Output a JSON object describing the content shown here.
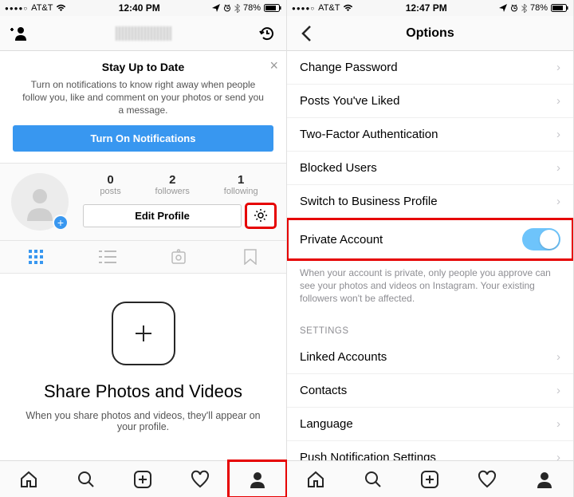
{
  "left": {
    "status": {
      "carrier": "AT&T",
      "time": "12:40 PM",
      "battery": "78%"
    },
    "banner": {
      "title": "Stay Up to Date",
      "body": "Turn on notifications to know right away when people follow you, like and comment on your photos or send you a message.",
      "cta": "Turn On Notifications"
    },
    "stats": {
      "posts_num": "0",
      "posts_lbl": "posts",
      "followers_num": "2",
      "followers_lbl": "followers",
      "following_num": "1",
      "following_lbl": "following"
    },
    "edit_label": "Edit Profile",
    "empty": {
      "title": "Share Photos and Videos",
      "body": "When you share photos and videos, they'll appear on your profile."
    }
  },
  "right": {
    "status": {
      "carrier": "AT&T",
      "time": "12:47 PM",
      "battery": "78%"
    },
    "title": "Options",
    "rows": {
      "change_password": "Change Password",
      "posts_liked": "Posts You've Liked",
      "two_factor": "Two-Factor Authentication",
      "blocked": "Blocked Users",
      "switch_business": "Switch to Business Profile",
      "private_account": "Private Account",
      "private_desc": "When your account is private, only people you approve can see your photos and videos on Instagram. Your existing followers won't be affected.",
      "settings_hdr": "SETTINGS",
      "linked": "Linked Accounts",
      "contacts": "Contacts",
      "language": "Language",
      "push": "Push Notification Settings"
    }
  }
}
